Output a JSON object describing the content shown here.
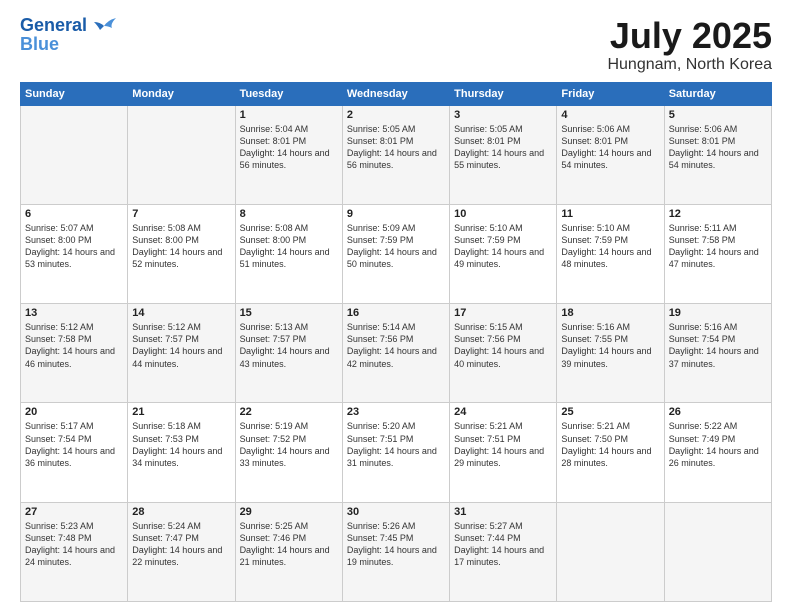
{
  "logo": {
    "line1": "General",
    "line2": "Blue"
  },
  "header": {
    "month": "July 2025",
    "location": "Hungnam, North Korea"
  },
  "weekdays": [
    "Sunday",
    "Monday",
    "Tuesday",
    "Wednesday",
    "Thursday",
    "Friday",
    "Saturday"
  ],
  "weeks": [
    [
      {
        "day": "",
        "sunrise": "",
        "sunset": "",
        "daylight": ""
      },
      {
        "day": "",
        "sunrise": "",
        "sunset": "",
        "daylight": ""
      },
      {
        "day": "1",
        "sunrise": "Sunrise: 5:04 AM",
        "sunset": "Sunset: 8:01 PM",
        "daylight": "Daylight: 14 hours and 56 minutes."
      },
      {
        "day": "2",
        "sunrise": "Sunrise: 5:05 AM",
        "sunset": "Sunset: 8:01 PM",
        "daylight": "Daylight: 14 hours and 56 minutes."
      },
      {
        "day": "3",
        "sunrise": "Sunrise: 5:05 AM",
        "sunset": "Sunset: 8:01 PM",
        "daylight": "Daylight: 14 hours and 55 minutes."
      },
      {
        "day": "4",
        "sunrise": "Sunrise: 5:06 AM",
        "sunset": "Sunset: 8:01 PM",
        "daylight": "Daylight: 14 hours and 54 minutes."
      },
      {
        "day": "5",
        "sunrise": "Sunrise: 5:06 AM",
        "sunset": "Sunset: 8:01 PM",
        "daylight": "Daylight: 14 hours and 54 minutes."
      }
    ],
    [
      {
        "day": "6",
        "sunrise": "Sunrise: 5:07 AM",
        "sunset": "Sunset: 8:00 PM",
        "daylight": "Daylight: 14 hours and 53 minutes."
      },
      {
        "day": "7",
        "sunrise": "Sunrise: 5:08 AM",
        "sunset": "Sunset: 8:00 PM",
        "daylight": "Daylight: 14 hours and 52 minutes."
      },
      {
        "day": "8",
        "sunrise": "Sunrise: 5:08 AM",
        "sunset": "Sunset: 8:00 PM",
        "daylight": "Daylight: 14 hours and 51 minutes."
      },
      {
        "day": "9",
        "sunrise": "Sunrise: 5:09 AM",
        "sunset": "Sunset: 7:59 PM",
        "daylight": "Daylight: 14 hours and 50 minutes."
      },
      {
        "day": "10",
        "sunrise": "Sunrise: 5:10 AM",
        "sunset": "Sunset: 7:59 PM",
        "daylight": "Daylight: 14 hours and 49 minutes."
      },
      {
        "day": "11",
        "sunrise": "Sunrise: 5:10 AM",
        "sunset": "Sunset: 7:59 PM",
        "daylight": "Daylight: 14 hours and 48 minutes."
      },
      {
        "day": "12",
        "sunrise": "Sunrise: 5:11 AM",
        "sunset": "Sunset: 7:58 PM",
        "daylight": "Daylight: 14 hours and 47 minutes."
      }
    ],
    [
      {
        "day": "13",
        "sunrise": "Sunrise: 5:12 AM",
        "sunset": "Sunset: 7:58 PM",
        "daylight": "Daylight: 14 hours and 46 minutes."
      },
      {
        "day": "14",
        "sunrise": "Sunrise: 5:12 AM",
        "sunset": "Sunset: 7:57 PM",
        "daylight": "Daylight: 14 hours and 44 minutes."
      },
      {
        "day": "15",
        "sunrise": "Sunrise: 5:13 AM",
        "sunset": "Sunset: 7:57 PM",
        "daylight": "Daylight: 14 hours and 43 minutes."
      },
      {
        "day": "16",
        "sunrise": "Sunrise: 5:14 AM",
        "sunset": "Sunset: 7:56 PM",
        "daylight": "Daylight: 14 hours and 42 minutes."
      },
      {
        "day": "17",
        "sunrise": "Sunrise: 5:15 AM",
        "sunset": "Sunset: 7:56 PM",
        "daylight": "Daylight: 14 hours and 40 minutes."
      },
      {
        "day": "18",
        "sunrise": "Sunrise: 5:16 AM",
        "sunset": "Sunset: 7:55 PM",
        "daylight": "Daylight: 14 hours and 39 minutes."
      },
      {
        "day": "19",
        "sunrise": "Sunrise: 5:16 AM",
        "sunset": "Sunset: 7:54 PM",
        "daylight": "Daylight: 14 hours and 37 minutes."
      }
    ],
    [
      {
        "day": "20",
        "sunrise": "Sunrise: 5:17 AM",
        "sunset": "Sunset: 7:54 PM",
        "daylight": "Daylight: 14 hours and 36 minutes."
      },
      {
        "day": "21",
        "sunrise": "Sunrise: 5:18 AM",
        "sunset": "Sunset: 7:53 PM",
        "daylight": "Daylight: 14 hours and 34 minutes."
      },
      {
        "day": "22",
        "sunrise": "Sunrise: 5:19 AM",
        "sunset": "Sunset: 7:52 PM",
        "daylight": "Daylight: 14 hours and 33 minutes."
      },
      {
        "day": "23",
        "sunrise": "Sunrise: 5:20 AM",
        "sunset": "Sunset: 7:51 PM",
        "daylight": "Daylight: 14 hours and 31 minutes."
      },
      {
        "day": "24",
        "sunrise": "Sunrise: 5:21 AM",
        "sunset": "Sunset: 7:51 PM",
        "daylight": "Daylight: 14 hours and 29 minutes."
      },
      {
        "day": "25",
        "sunrise": "Sunrise: 5:21 AM",
        "sunset": "Sunset: 7:50 PM",
        "daylight": "Daylight: 14 hours and 28 minutes."
      },
      {
        "day": "26",
        "sunrise": "Sunrise: 5:22 AM",
        "sunset": "Sunset: 7:49 PM",
        "daylight": "Daylight: 14 hours and 26 minutes."
      }
    ],
    [
      {
        "day": "27",
        "sunrise": "Sunrise: 5:23 AM",
        "sunset": "Sunset: 7:48 PM",
        "daylight": "Daylight: 14 hours and 24 minutes."
      },
      {
        "day": "28",
        "sunrise": "Sunrise: 5:24 AM",
        "sunset": "Sunset: 7:47 PM",
        "daylight": "Daylight: 14 hours and 22 minutes."
      },
      {
        "day": "29",
        "sunrise": "Sunrise: 5:25 AM",
        "sunset": "Sunset: 7:46 PM",
        "daylight": "Daylight: 14 hours and 21 minutes."
      },
      {
        "day": "30",
        "sunrise": "Sunrise: 5:26 AM",
        "sunset": "Sunset: 7:45 PM",
        "daylight": "Daylight: 14 hours and 19 minutes."
      },
      {
        "day": "31",
        "sunrise": "Sunrise: 5:27 AM",
        "sunset": "Sunset: 7:44 PM",
        "daylight": "Daylight: 14 hours and 17 minutes."
      },
      {
        "day": "",
        "sunrise": "",
        "sunset": "",
        "daylight": ""
      },
      {
        "day": "",
        "sunrise": "",
        "sunset": "",
        "daylight": ""
      }
    ]
  ]
}
